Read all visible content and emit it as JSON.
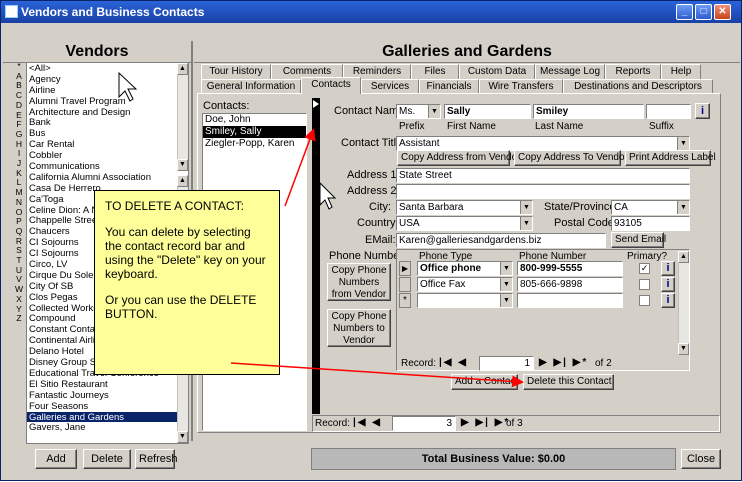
{
  "window": {
    "title": "Vendors and Business Contacts"
  },
  "vendors": {
    "title": "Vendors",
    "alphabet": [
      "*",
      "A",
      "B",
      "C",
      "D",
      "E",
      "F",
      "G",
      "H",
      "I",
      "J",
      "K",
      "L",
      "M",
      "N",
      "O",
      "P",
      "Q",
      "R",
      "S",
      "T",
      "U",
      "V",
      "W",
      "X",
      "Y",
      "Z"
    ],
    "items": [
      "<All>",
      "Agency",
      "Airline",
      "Alumni Travel Program",
      "Architecture and Design",
      "Bank",
      "Bus",
      "Car Rental",
      "Cobbler",
      "Communications",
      "California Alumni Association",
      "Casa De Herrero",
      "Ca'Toga",
      "Celine Dion: A New Day",
      "Chappelle Street",
      "Chaucers",
      "CI Sojourns",
      "CI Sojourns",
      "Circo, LV",
      "Cirque Du Soleil-\"",
      "City Of SB",
      "Clos Pegas",
      "Collected Works B",
      "Compound",
      "Constant Contact",
      "Continental Airlines",
      "Delano Hotel",
      "Disney Group Sales",
      "Educational Travel Conference",
      "El Sitio Restaurant",
      "Fantastic Journeys",
      "Four Seasons",
      "Galleries and Gardens",
      "Gavers, Jane"
    ],
    "selected_index": 32,
    "buttons": {
      "add": "Add",
      "delete": "Delete",
      "refresh": "Refresh"
    }
  },
  "main": {
    "title": "Galleries and Gardens",
    "tabs_row1": [
      "Tour History",
      "Comments",
      "Reminders",
      "Files",
      "Custom Data",
      "Message Log",
      "Reports",
      "Help"
    ],
    "tabs_row2": [
      "General Information",
      "Contacts",
      "Services",
      "Financials",
      "Wire Transfers",
      "Destinations and Descriptors"
    ],
    "active_tab": "Contacts",
    "contacts_label": "Contacts:",
    "contacts": [
      "Doe, John",
      "Smiley, Sally",
      "Ziegler-Popp, Karen"
    ],
    "selected_contact": 1,
    "form": {
      "contact_name_label": "Contact Name:",
      "prefix": "Ms.",
      "first_name": "Sally",
      "last_name": "Smiley",
      "suffix": "",
      "info_btn": "i",
      "prefix_label": "Prefix",
      "first_label": "First Name",
      "last_label": "Last Name",
      "suffix_label": "Suffix",
      "title_label": "Contact Title:",
      "title": "Assistant",
      "copy_from_vendor": "Copy Address from Vendor",
      "copy_to_vendor": "Copy Address To Vendor",
      "print_label": "Print Address Label",
      "address1_label": "Address 1:",
      "address1": "State Street",
      "address2_label": "Address 2:",
      "address2": "",
      "city_label": "City:",
      "city": "Santa Barbara",
      "state_label": "State/Province:",
      "state": "CA",
      "country_label": "Country:",
      "country": "USA",
      "postal_label": "Postal Code:",
      "postal": "93105",
      "email_label": "EMail:",
      "email": "Karen@galleriesandgardens.biz",
      "send_email": "Send Email",
      "phone_label": "Phone Numbers:",
      "copy_phone_from": "Copy Phone Numbers from Vendor",
      "copy_phone_to": "Copy Phone Numbers to Vendor",
      "phone_headers": {
        "type": "Phone Type",
        "number": "Phone Number",
        "primary": "Primary?"
      },
      "phones": [
        {
          "type": "Office phone",
          "number": "800-999-5555",
          "primary": true
        },
        {
          "type": "Office Fax",
          "number": "805-666-9898",
          "primary": false
        }
      ],
      "phone_nav": {
        "label": "Record:",
        "current": "1",
        "of": "of 2"
      },
      "add_contact": "Add a Contact",
      "delete_contact": "Delete this Contact"
    },
    "contact_nav": {
      "label": "Record:",
      "current": "3",
      "of": "of 3"
    }
  },
  "note": {
    "title": "TO DELETE A CONTACT:",
    "p1": "You can delete by selecting the contact record bar and using the \"Delete\" key on your keyboard.",
    "p2": "Or you can use the DELETE BUTTON."
  },
  "footer": {
    "total": "Total Business Value: $0.00",
    "close": "Close"
  },
  "colors": {
    "title_blue": "#1941a5",
    "selection": "#0a246a",
    "note_bg": "#ffff99",
    "arrow_red": "#ff0000"
  }
}
